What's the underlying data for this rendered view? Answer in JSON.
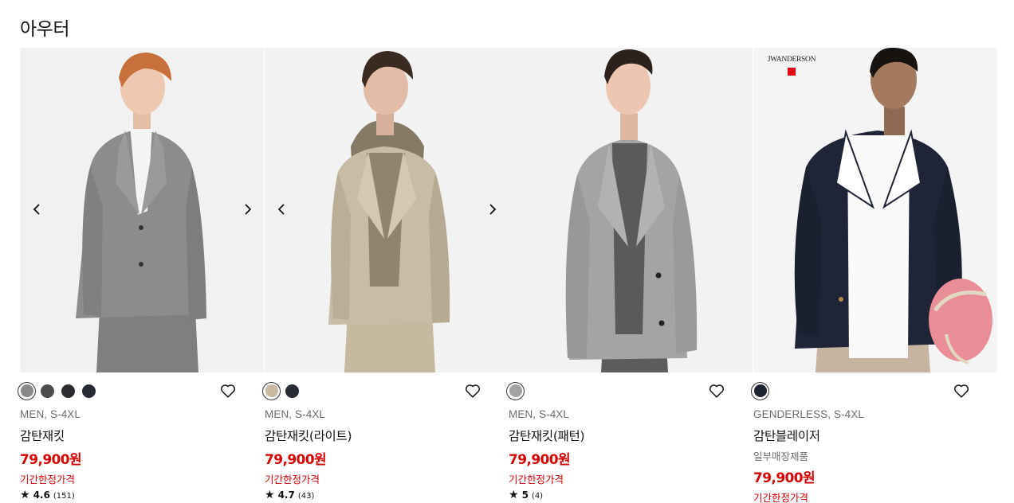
{
  "section": {
    "title": "아우터"
  },
  "colors": {
    "price": "#d50000",
    "promo": "#d50000",
    "meta": "#6b6b6b",
    "brand_box": "#e60012"
  },
  "icons": {
    "prev": "chevron-left-icon",
    "next": "chevron-right-icon",
    "wishlist": "heart-icon",
    "star": "star-icon"
  },
  "products": [
    {
      "meta": "MEN, S-4XL",
      "name": "감탄재킷",
      "price": "79,900원",
      "promo": "기간한정가격",
      "rating": {
        "star": "★",
        "score": "4.6",
        "count": "(151)"
      },
      "swatches": [
        "#8a8a8a",
        "#4d4d4d",
        "#2b2d31",
        "#262a33"
      ],
      "selected_swatch": 0,
      "has_carousel": true
    },
    {
      "meta": "MEN, S-4XL",
      "name": "감탄재킷(라이트)",
      "price": "79,900원",
      "promo": "기간한정가격",
      "rating": {
        "star": "★",
        "score": "4.7",
        "count": "(43)"
      },
      "swatches": [
        "#c9b9a1",
        "#262a33"
      ],
      "selected_swatch": 0,
      "has_carousel": true
    },
    {
      "meta": "MEN, S-4XL",
      "name": "감탄재킷(패턴)",
      "price": "79,900원",
      "promo": "기간한정가격",
      "rating": {
        "star": "★",
        "score": "5",
        "count": "(4)"
      },
      "swatches": [
        "#a2a2a2"
      ],
      "selected_swatch": 0,
      "has_carousel": false
    },
    {
      "meta": "GENDERLESS, S-4XL",
      "name": "감탄블레이저",
      "note": "일부매장제품",
      "price": "79,900원",
      "promo": "기간한정가격",
      "swatches": [
        "#1f2435"
      ],
      "selected_swatch": 0,
      "has_carousel": false,
      "brand_logo": "JWANDERSON"
    }
  ]
}
